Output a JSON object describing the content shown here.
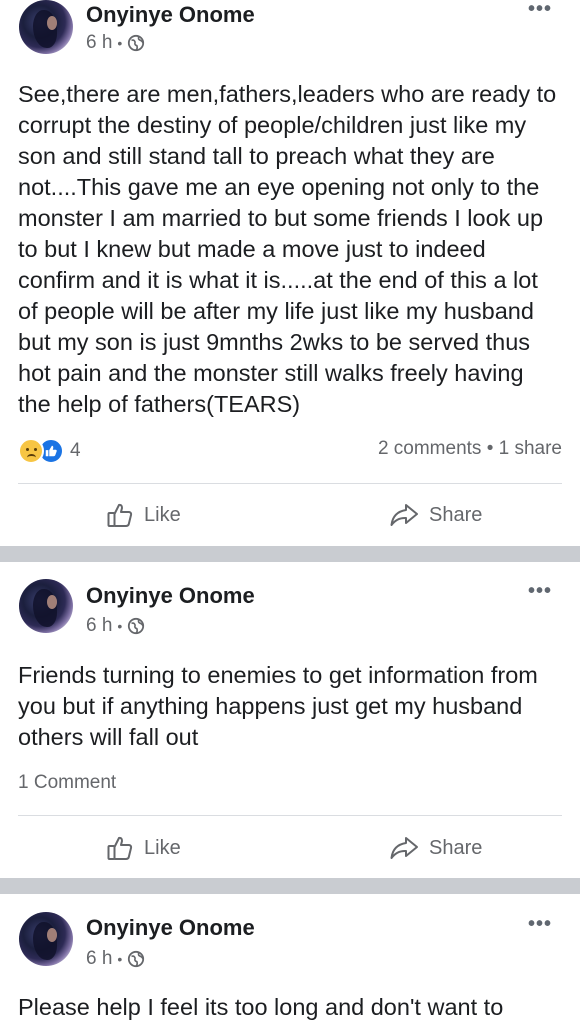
{
  "posts": [
    {
      "author": "Onyinye Onome",
      "time": "6 h",
      "text": "See,there are men,fathers,leaders who are ready to corrupt the destiny of people/children just like my son and still stand tall to preach what they are not....This gave me an eye opening not only to the monster I am married to but some friends I look up to but I knew but made a move just to indeed confirm and it is what it is.....at the end of this a lot of people  will be after my life just like my husband but my son is just 9mnths 2wks to be served thus hot pain and the monster still walks freely having the help of  fathers(TEARS)",
      "reaction_count": "4",
      "reaction_icons": [
        "sad-reaction-icon",
        "like-reaction-icon"
      ],
      "comments_shares": "2 comments • 1 share",
      "like_label": "Like",
      "share_label": "Share"
    },
    {
      "author": "Onyinye Onome",
      "time": "6 h",
      "text": "Friends turning to enemies to get information from you but if anything happens just get my husband others will fall out",
      "comments": "1 Comment",
      "like_label": "Like",
      "share_label": "Share"
    },
    {
      "author": "Onyinye Onome",
      "time": "6 h",
      "text": "Please help I feel its too long and don't want to"
    }
  ],
  "icons": {
    "privacy": "globe-icon",
    "menu": "more-options-icon",
    "like": "thumbs-up-icon",
    "share": "share-arrow-icon"
  },
  "colors": {
    "text": "#1c1e21",
    "secondary": "#65676b",
    "separator": "#c9ccd1",
    "like_blue": "#1b74e4",
    "sad_yellow": "#f7c544"
  }
}
